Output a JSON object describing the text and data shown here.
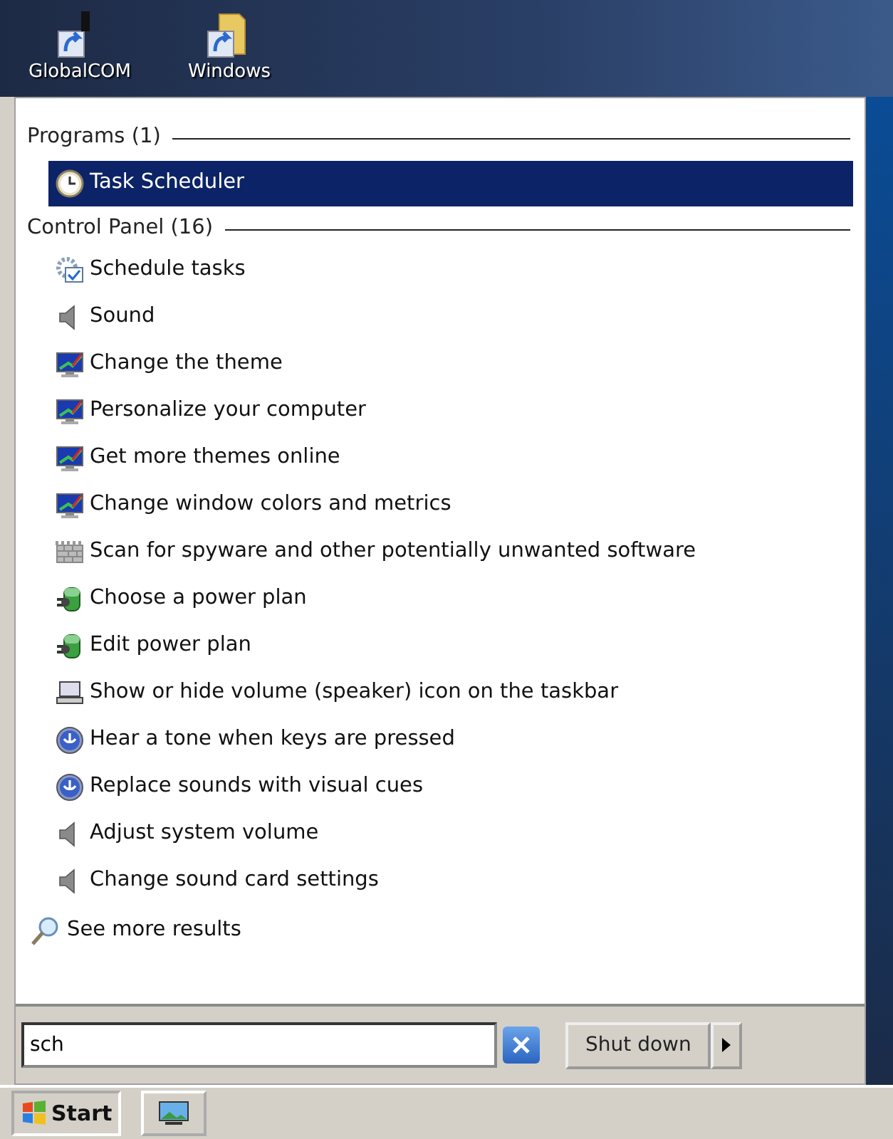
{
  "desktop_icons": [
    {
      "label": "GlobalCOM",
      "kind": "shortcut"
    },
    {
      "label": "Windows",
      "kind": "folder"
    }
  ],
  "groups": [
    {
      "title": "Programs (1)",
      "items": [
        {
          "label": "Task Scheduler",
          "kind": "clock",
          "selected": true
        }
      ]
    },
    {
      "title": "Control Panel (16)",
      "items": [
        {
          "label": "Schedule tasks",
          "kind": "gear",
          "selected": false
        },
        {
          "label": "Sound",
          "kind": "speaker",
          "selected": false
        },
        {
          "label": "Change the theme",
          "kind": "monitor",
          "selected": false
        },
        {
          "label": "Personalize your computer",
          "kind": "monitor",
          "selected": false
        },
        {
          "label": "Get more themes online",
          "kind": "monitor",
          "selected": false
        },
        {
          "label": "Change window colors and metrics",
          "kind": "monitor",
          "selected": false
        },
        {
          "label": "Scan for spyware and other potentially unwanted software",
          "kind": "wall",
          "selected": false
        },
        {
          "label": "Choose a power plan",
          "kind": "power",
          "selected": false
        },
        {
          "label": "Edit power plan",
          "kind": "power",
          "selected": false
        },
        {
          "label": "Show or hide volume (speaker) icon on the taskbar",
          "kind": "laptop",
          "selected": false
        },
        {
          "label": "Hear a tone when keys are pressed",
          "kind": "access",
          "selected": false
        },
        {
          "label": "Replace sounds with visual cues",
          "kind": "access",
          "selected": false
        },
        {
          "label": "Adjust system volume",
          "kind": "speaker",
          "selected": false
        },
        {
          "label": "Change sound card settings",
          "kind": "speaker",
          "selected": false
        }
      ]
    }
  ],
  "see_more": "See more results",
  "search": {
    "value": "sch"
  },
  "shutdown": {
    "label": "Shut down"
  },
  "taskbar": {
    "start_label": "Start"
  }
}
